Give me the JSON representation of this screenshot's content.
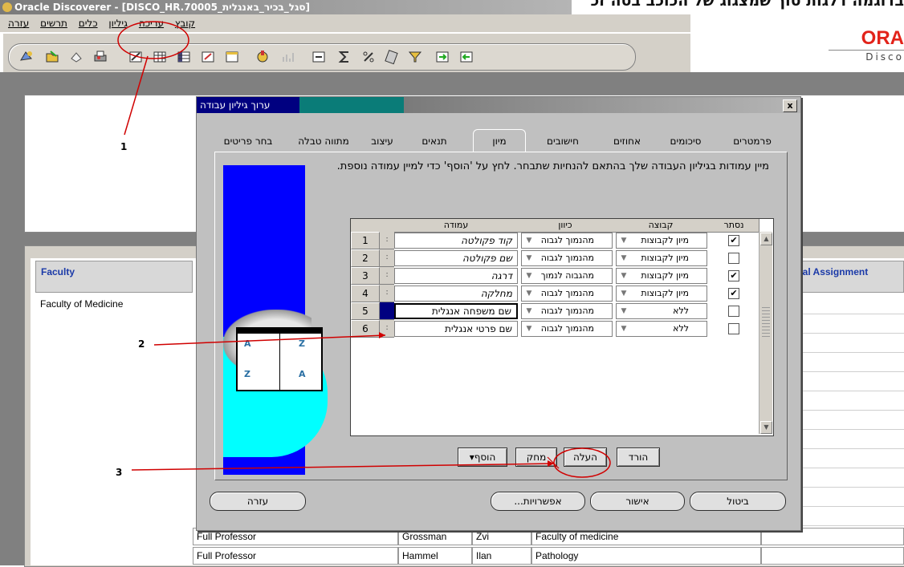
{
  "top_heading": "בדוגמה דלגות סוך שמצגוג של הכוכב בסה זכ",
  "window": {
    "title": "Oracle Discoverer - [DISCO_HR.70005_סגל_בכיר_באנגלית]"
  },
  "menu": [
    "קובץ",
    "עריכה",
    "גיליון",
    "כלים",
    "תרשים",
    "עזרה"
  ],
  "oracle_logo": {
    "text": "ORA",
    "sub": "Disco"
  },
  "worksheet": {
    "faculty_header": "Faculty",
    "faculty_value": "Faculty of Medicine",
    "additional_header": "Additional Assignment",
    "rows": [
      {
        "rank": "Full Professor",
        "last": "Grossman",
        "first": "Zvi",
        "dept": "Faculty of medicine"
      },
      {
        "rank": "Full Professor",
        "last": "Hammel",
        "first": "Ilan",
        "dept": "Pathology"
      }
    ]
  },
  "dialog": {
    "title": "ערוך גיליון עבודה",
    "close": "x",
    "tabs": [
      "בחר פריטים",
      "מתווה טבלה",
      "עיצוב",
      "תנאים",
      "מיון",
      "חישובים",
      "אחוזים",
      "סיכומים",
      "פרמטרים"
    ],
    "active_tab": "מיון",
    "instructions": "מיין עמודות בגיליון העבודה שלך בהתאם להנחיות שתבחר. לחץ על 'הוסף' כדי למיין עמודה נוספת.",
    "grid_headers": {
      "column": "עמודה",
      "direction": "כיוון",
      "group": "קבוצה",
      "hidden": "נסתר"
    },
    "rows": [
      {
        "num": "1",
        "column": "קוד פקולטה",
        "direction": "מהנמוך לגבוה",
        "group": "מיון לקבוצות",
        "hidden": true
      },
      {
        "num": "2",
        "column": "שם פקולטה",
        "direction": "מהנמוך לגבוה",
        "group": "מיון לקבוצות",
        "hidden": false
      },
      {
        "num": "3",
        "column": "דרגה",
        "direction": "מהגבוה לנמוך",
        "group": "מיון לקבוצות",
        "hidden": true
      },
      {
        "num": "4",
        "column": "מחלקה",
        "direction": "מהנמוך לגבוה",
        "group": "מיון לקבוצות",
        "hidden": true
      },
      {
        "num": "5",
        "column": "שם משפחה אנגלית",
        "direction": "מהנמוך לגבוה",
        "group": "ללא",
        "hidden": false
      },
      {
        "num": "6",
        "column": "שם פרטי אנגלית",
        "direction": "מהנמוך לגבוה",
        "group": "ללא",
        "hidden": false
      }
    ],
    "illustration": {
      "a1": "A",
      "z1": "Z",
      "z2": "Z",
      "a2": "A"
    },
    "row_buttons": {
      "add": "הוסף",
      "delete": "מחק",
      "move_up": "העלה",
      "move_down": "הורד"
    },
    "footer": {
      "help": "עזרה",
      "options": "אפשרויות...",
      "ok": "אישור",
      "cancel": "ביטול"
    }
  },
  "annotations": [
    "1",
    "2",
    "3"
  ],
  "annotation_color": "#d00000"
}
